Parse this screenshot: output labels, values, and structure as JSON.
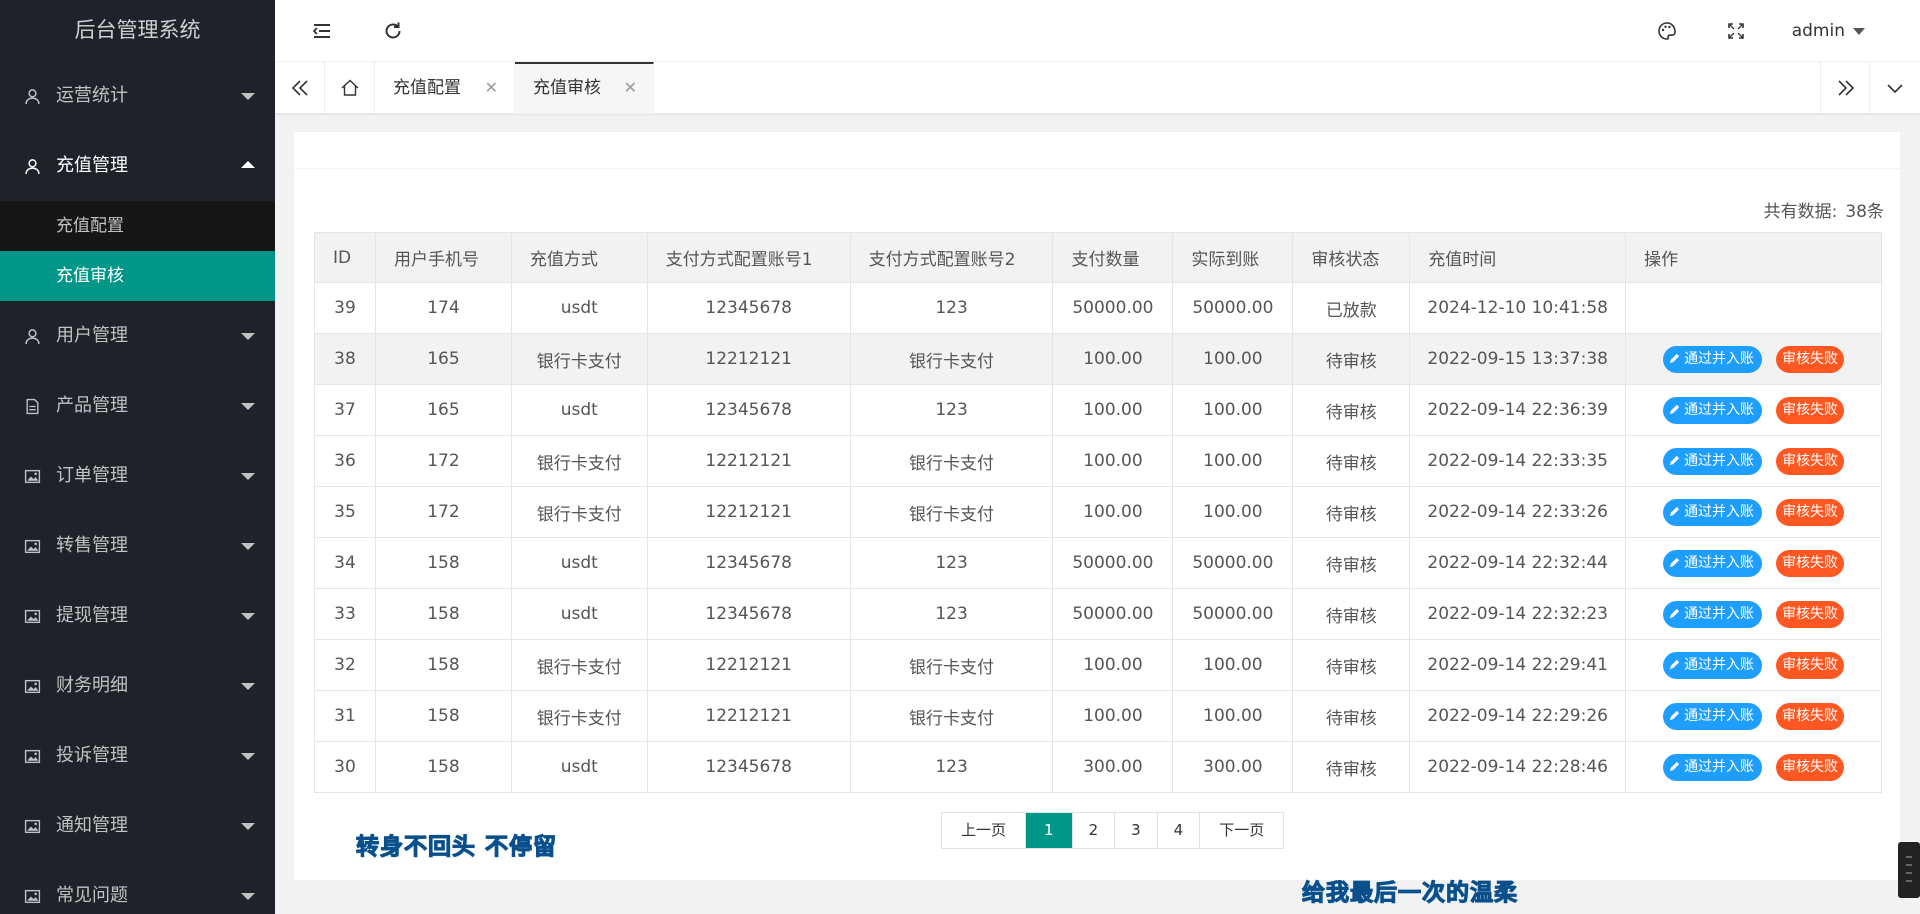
{
  "app": {
    "title": "后台管理系统"
  },
  "sidebar": {
    "items": [
      {
        "label": "运营统计",
        "icon": "user-icon",
        "open": false
      },
      {
        "label": "充值管理",
        "icon": "user-icon",
        "open": true,
        "children": [
          {
            "label": "充值配置",
            "active": false
          },
          {
            "label": "充值审核",
            "active": true
          }
        ]
      },
      {
        "label": "用户管理",
        "icon": "user-icon",
        "open": false
      },
      {
        "label": "产品管理",
        "icon": "document-icon",
        "open": false
      },
      {
        "label": "订单管理",
        "icon": "image-icon",
        "open": false
      },
      {
        "label": "转售管理",
        "icon": "image-icon",
        "open": false
      },
      {
        "label": "提现管理",
        "icon": "image-icon",
        "open": false
      },
      {
        "label": "财务明细",
        "icon": "image-icon",
        "open": false
      },
      {
        "label": "投诉管理",
        "icon": "image-icon",
        "open": false
      },
      {
        "label": "通知管理",
        "icon": "image-icon",
        "open": false
      },
      {
        "label": "常见问题",
        "icon": "image-icon",
        "open": false
      }
    ]
  },
  "header": {
    "icons": [
      "menu-collapse-icon",
      "refresh-icon",
      "palette-icon",
      "fullscreen-icon"
    ],
    "user": "admin"
  },
  "tabs": {
    "items": [
      {
        "label": "充值配置",
        "active": false
      },
      {
        "label": "充值审核",
        "active": true
      }
    ]
  },
  "main": {
    "total_label": "共有数据:",
    "total_value": "38条",
    "columns": [
      "ID",
      "用户手机号",
      "充值方式",
      "支付方式配置账号1",
      "支付方式配置账号2",
      "支付数量",
      "实际到账",
      "审核状态",
      "充值时间",
      "操作"
    ],
    "rows": [
      {
        "id": "39",
        "phone": "174",
        "method": "usdt",
        "acc1": "12345678",
        "acc2": "123",
        "amount": "50000.00",
        "received": "50000.00",
        "status": "已放款",
        "time": "2024-12-10 10:41:58",
        "actions": false
      },
      {
        "id": "38",
        "phone": "165",
        "method": "银行卡支付",
        "acc1": "12212121",
        "acc2": "银行卡支付",
        "amount": "100.00",
        "received": "100.00",
        "status": "待审核",
        "time": "2022-09-15 13:37:38",
        "actions": true
      },
      {
        "id": "37",
        "phone": "165",
        "method": "usdt",
        "acc1": "12345678",
        "acc2": "123",
        "amount": "100.00",
        "received": "100.00",
        "status": "待审核",
        "time": "2022-09-14 22:36:39",
        "actions": true
      },
      {
        "id": "36",
        "phone": "172",
        "method": "银行卡支付",
        "acc1": "12212121",
        "acc2": "银行卡支付",
        "amount": "100.00",
        "received": "100.00",
        "status": "待审核",
        "time": "2022-09-14 22:33:35",
        "actions": true
      },
      {
        "id": "35",
        "phone": "172",
        "method": "银行卡支付",
        "acc1": "12212121",
        "acc2": "银行卡支付",
        "amount": "100.00",
        "received": "100.00",
        "status": "待审核",
        "time": "2022-09-14 22:33:26",
        "actions": true
      },
      {
        "id": "34",
        "phone": "158",
        "method": "usdt",
        "acc1": "12345678",
        "acc2": "123",
        "amount": "50000.00",
        "received": "50000.00",
        "status": "待审核",
        "time": "2022-09-14 22:32:44",
        "actions": true
      },
      {
        "id": "33",
        "phone": "158",
        "method": "usdt",
        "acc1": "12345678",
        "acc2": "123",
        "amount": "50000.00",
        "received": "50000.00",
        "status": "待审核",
        "time": "2022-09-14 22:32:23",
        "actions": true
      },
      {
        "id": "32",
        "phone": "158",
        "method": "银行卡支付",
        "acc1": "12212121",
        "acc2": "银行卡支付",
        "amount": "100.00",
        "received": "100.00",
        "status": "待审核",
        "time": "2022-09-14 22:29:41",
        "actions": true
      },
      {
        "id": "31",
        "phone": "158",
        "method": "银行卡支付",
        "acc1": "12212121",
        "acc2": "银行卡支付",
        "amount": "100.00",
        "received": "100.00",
        "status": "待审核",
        "time": "2022-09-14 22:29:26",
        "actions": true
      },
      {
        "id": "30",
        "phone": "158",
        "method": "usdt",
        "acc1": "12345678",
        "acc2": "123",
        "amount": "300.00",
        "received": "300.00",
        "status": "待审核",
        "time": "2022-09-14 22:28:46",
        "actions": true
      }
    ],
    "actions": {
      "approve": "通过并入账",
      "reject": "审核失败"
    }
  },
  "pagination": {
    "prev": "上一页",
    "pages": [
      "1",
      "2",
      "3",
      "4"
    ],
    "current": "1",
    "next": "下一页"
  },
  "overlay": {
    "caption_left": "转身不回头 不停留",
    "caption_right": "给我最后一次的温柔"
  },
  "colors": {
    "sidebar_bg": "#20222a",
    "active_green": "#009688",
    "approve_blue": "#1e9fff",
    "reject_orange": "#ff5722"
  }
}
